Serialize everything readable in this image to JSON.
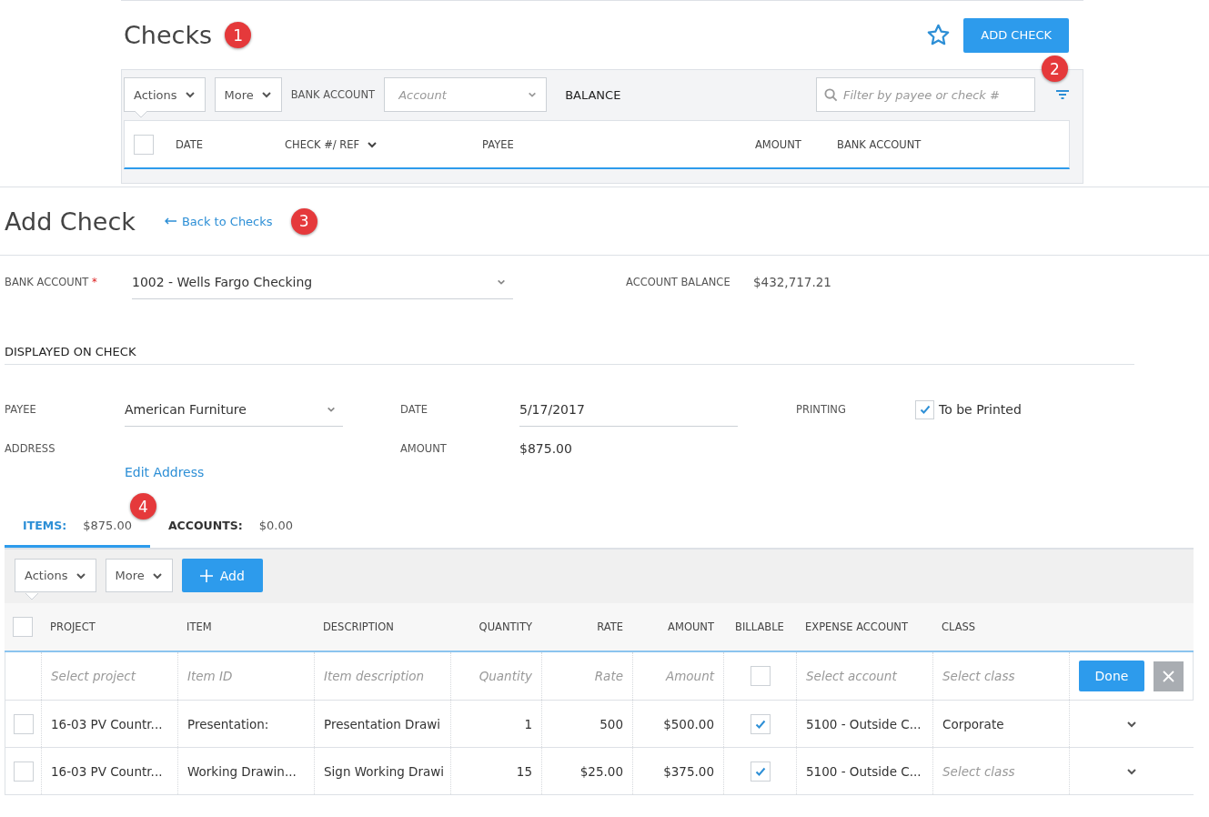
{
  "checks_page": {
    "title": "Checks",
    "callout": "1",
    "add_button": "ADD CHECK",
    "callout_2": "2",
    "toolbar": {
      "actions": "Actions",
      "more": "More",
      "bank_account_label": "BANK ACCOUNT",
      "account_placeholder": "Account",
      "balance_label": "BALANCE",
      "search_placeholder": "Filter by payee or check #"
    },
    "select_all": false,
    "columns": [
      {
        "label": "DATE",
        "sortable": false
      },
      {
        "label": "CHECK #/ REF",
        "sortable": true
      },
      {
        "label": "PAYEE",
        "sortable": false
      },
      {
        "label": "AMOUNT",
        "sortable": false
      },
      {
        "label": "BANK ACCOUNT",
        "sortable": false
      }
    ]
  },
  "add_check": {
    "title": "Add Check",
    "back_link": "Back to Checks",
    "callout": "3",
    "bank_account": {
      "label": "BANK ACCOUNT",
      "required": "*",
      "value": "1002 - Wells Fargo Checking"
    },
    "account_balance": {
      "label": "ACCOUNT BALANCE",
      "value": "$432,717.21"
    },
    "section_title": "DISPLAYED ON CHECK",
    "payee": {
      "label": "PAYEE",
      "value": "American Furniture"
    },
    "date": {
      "label": "DATE",
      "value": "5/17/2017"
    },
    "printing": {
      "label": "PRINTING",
      "option": "To be Printed",
      "checked": true
    },
    "address": {
      "label": "ADDRESS",
      "link": "Edit Address"
    },
    "amount": {
      "label": "AMOUNT",
      "value": "$875.00"
    }
  },
  "tabs": [
    {
      "label": "ITEMS:",
      "amount": "$875.00",
      "selected": true
    },
    {
      "label": "ACCOUNTS:",
      "amount": "$0.00",
      "selected": false
    }
  ],
  "tabs_callout": "4",
  "items_table": {
    "toolbar": {
      "actions": "Actions",
      "more": "More",
      "add": "Add"
    },
    "select_all": false,
    "columns": [
      "PROJECT",
      "ITEM",
      "DESCRIPTION",
      "QUANTITY",
      "RATE",
      "AMOUNT",
      "BILLABLE",
      "EXPENSE ACCOUNT",
      "CLASS"
    ],
    "entry_row": {
      "placeholders": [
        "Select project",
        "Item ID",
        "Item description",
        "Quantity",
        "Rate",
        "Amount"
      ],
      "billable": false,
      "account_placeholder": "Select account",
      "class_placeholder": "Select class",
      "done": "Done"
    },
    "rows": [
      {
        "selected": false,
        "cells": [
          "16-03 PV Countr...",
          "Presentation:",
          "Presentation Drawi",
          "1",
          "500",
          "$500.00"
        ],
        "billable": true,
        "account": "5100 - Outside C...",
        "class": "Corporate",
        "class_placeholder": false
      },
      {
        "selected": false,
        "cells": [
          "16-03 PV Countr...",
          "Working Drawin...",
          "Sign Working Drawi",
          "15",
          "$25.00",
          "$375.00"
        ],
        "billable": true,
        "account": "5100 - Outside C...",
        "class": "Select class",
        "class_placeholder": true
      }
    ]
  }
}
